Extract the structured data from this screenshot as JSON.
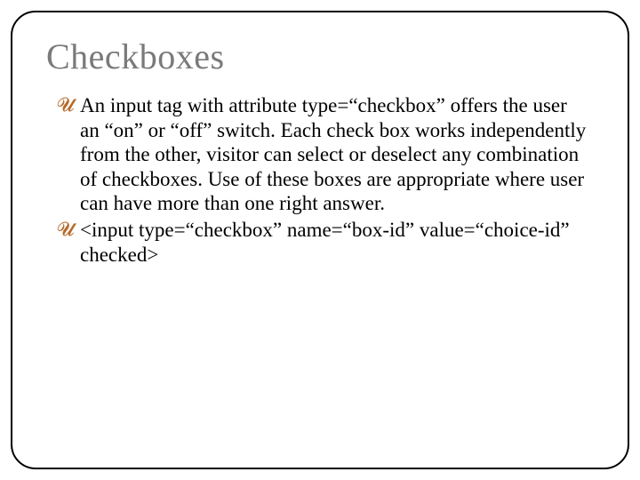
{
  "slide": {
    "title": "Checkboxes",
    "items": [
      {
        "text": "An input tag with attribute type=“checkbox” offers the user an “on” or “off” switch. Each check box works independently from the other, visitor can select or deselect any combination of checkboxes. Use of these boxes are appropriate where user can have more than one right answer."
      },
      {
        "text": "<input type=“checkbox” name=“box-id” value=“choice-id” checked>"
      }
    ]
  }
}
